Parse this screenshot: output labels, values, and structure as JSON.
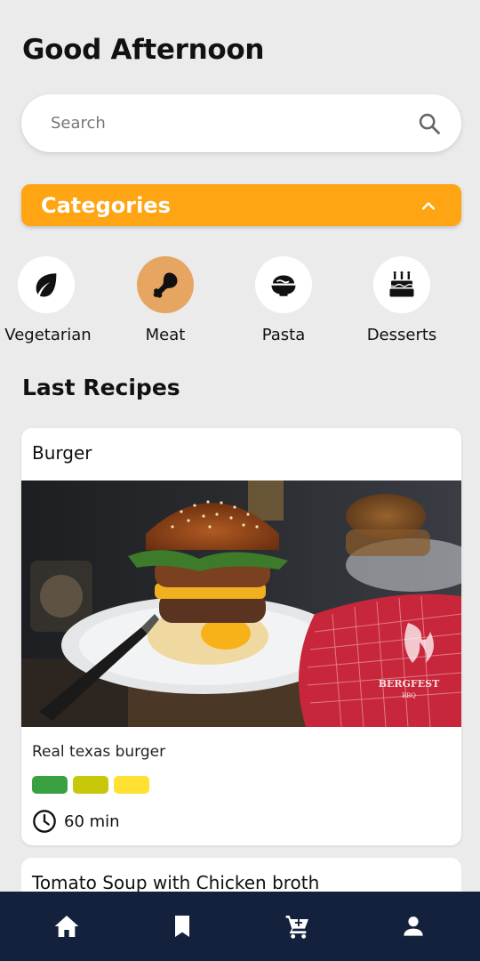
{
  "header": {
    "greeting": "Good Afternoon"
  },
  "search": {
    "placeholder": "Search"
  },
  "categories": {
    "title": "Categories",
    "items": [
      {
        "label": "Vegetarian",
        "icon": "leaf-icon"
      },
      {
        "label": "Meat",
        "icon": "drumstick-icon",
        "selected": true
      },
      {
        "label": "Pasta",
        "icon": "bowl-icon"
      },
      {
        "label": "Desserts",
        "icon": "cake-icon"
      }
    ]
  },
  "recipes": {
    "section_title": "Last Recipes",
    "items": [
      {
        "title": "Burger",
        "description": "Real texas burger",
        "tags": [
          "#3aa143",
          "#c8c80a",
          "#ffe033"
        ],
        "time": "60 min",
        "image_watermark": {
          "line1": "BERGFEST",
          "line2": "BBQ"
        }
      },
      {
        "title": "Tomato Soup with Chicken broth"
      }
    ]
  },
  "colors": {
    "accent": "#ffa412",
    "nav_bg": "#14213d",
    "selected_category": "#e6a561"
  },
  "bottom_nav": [
    {
      "name": "home",
      "icon": "home-icon",
      "active": true
    },
    {
      "name": "bookmarks",
      "icon": "bookmark-icon"
    },
    {
      "name": "cart",
      "icon": "cart-icon"
    },
    {
      "name": "profile",
      "icon": "person-icon"
    }
  ]
}
